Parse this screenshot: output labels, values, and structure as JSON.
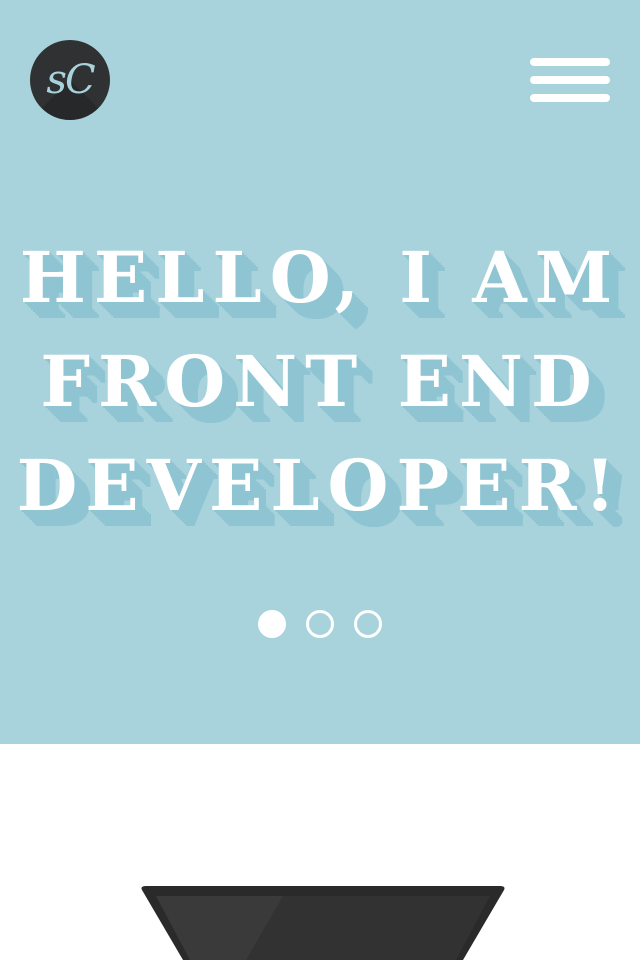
{
  "header": {
    "logo_text": "sC",
    "menu_icon": "hamburger-menu-icon"
  },
  "hero": {
    "headline_lines": [
      "HELLO, I AM",
      "FRONT END",
      "DEVELOPER!"
    ],
    "slider": {
      "total": 3,
      "active_index": 0
    }
  },
  "colors": {
    "hero_background": "#a8d3dd",
    "headline_text": "#ffffff",
    "headline_shadow": "#8fc5d2",
    "logo_background": "#2f3132",
    "logo_text": "#a8d3dd",
    "page_background": "#ffffff",
    "device_dark": "#2a2a2a"
  },
  "icons": {
    "device": "laptop-icon"
  }
}
